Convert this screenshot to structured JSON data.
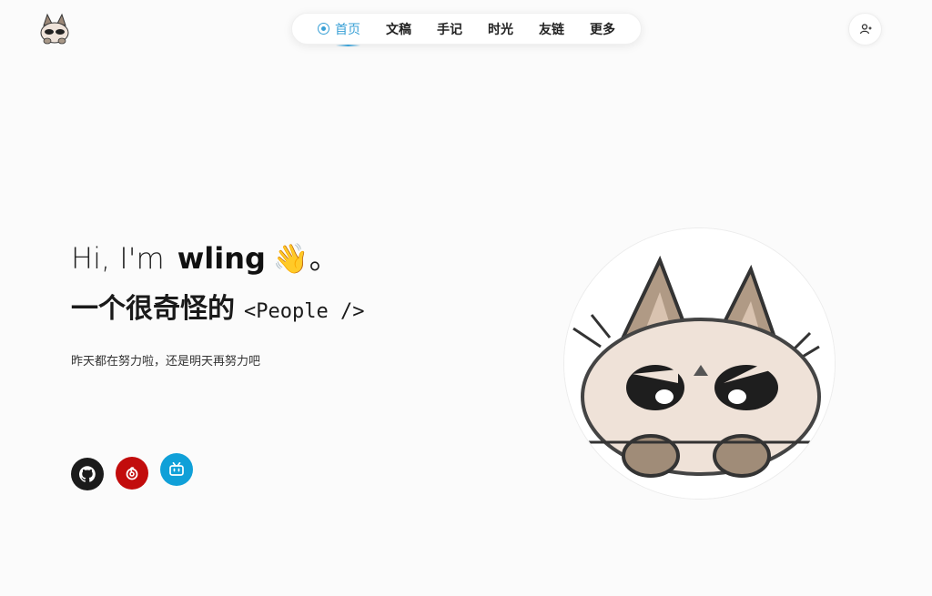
{
  "header": {
    "nav": [
      {
        "label": "首页",
        "active": true
      },
      {
        "label": "文稿"
      },
      {
        "label": "手记"
      },
      {
        "label": "时光"
      },
      {
        "label": "友链"
      },
      {
        "label": "更多"
      }
    ]
  },
  "hero": {
    "greeting": "Hi, I'm",
    "name": "wling",
    "wave_emoji": "👋",
    "period": "。",
    "subtitle": "一个很奇怪的",
    "code_tag": "<People />",
    "tagline": "昨天都在努力啦，还是明天再努力吧"
  },
  "social": [
    {
      "name": "github-icon",
      "color": "#1b1b1b"
    },
    {
      "name": "netease-music-icon",
      "color": "#c20c0c"
    },
    {
      "name": "bilibili-icon",
      "color": "#10a0d8"
    }
  ],
  "colors": {
    "accent": "#39a0d6",
    "background": "#fbfbfb"
  }
}
